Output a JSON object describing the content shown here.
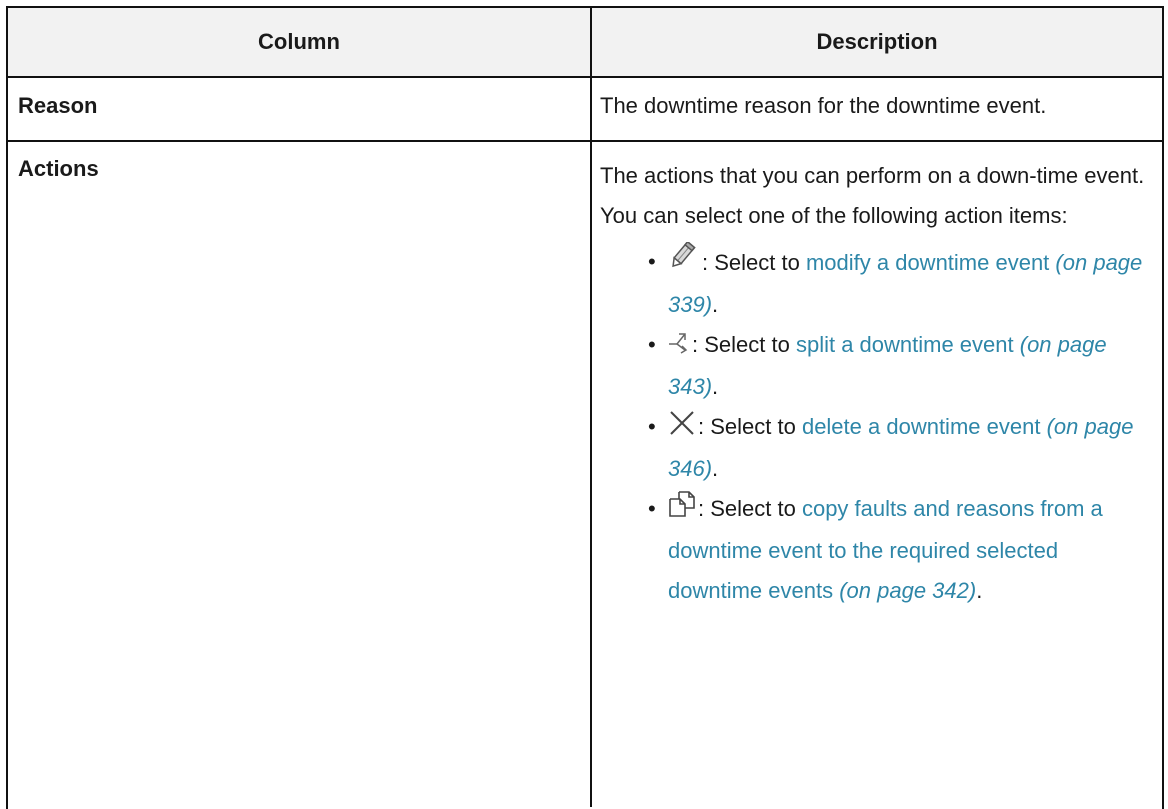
{
  "table": {
    "headers": {
      "column": "Column",
      "description": "Description"
    },
    "reason": {
      "name": "Reason",
      "description": "The downtime reason for the downtime event."
    },
    "actions": {
      "name": "Actions",
      "intro": "The actions that you can perform on a down-time event. You can select one of the following action items:",
      "items": [
        {
          "icon": "pencil-icon",
          "text": ": Select to ",
          "link": "modify a downtime event",
          "pageref": "(on page 339)",
          "end": "."
        },
        {
          "icon": "split-icon",
          "text": ": Select to ",
          "link": "split a downtime event",
          "pageref": "(on page 343)",
          "end": "."
        },
        {
          "icon": "close-icon",
          "text": ": Select to ",
          "link": "delete a downtime event",
          "pageref": "(on page 346)",
          "end": "."
        },
        {
          "icon": "copy-icon",
          "text": ": Select to ",
          "link": "copy faults and reasons from a downtime event to the required selected downtime events",
          "pageref": "(on page 342)",
          "end": "."
        }
      ]
    }
  },
  "colors": {
    "link": "#2e86a8",
    "header_bg": "#f2f2f2"
  }
}
